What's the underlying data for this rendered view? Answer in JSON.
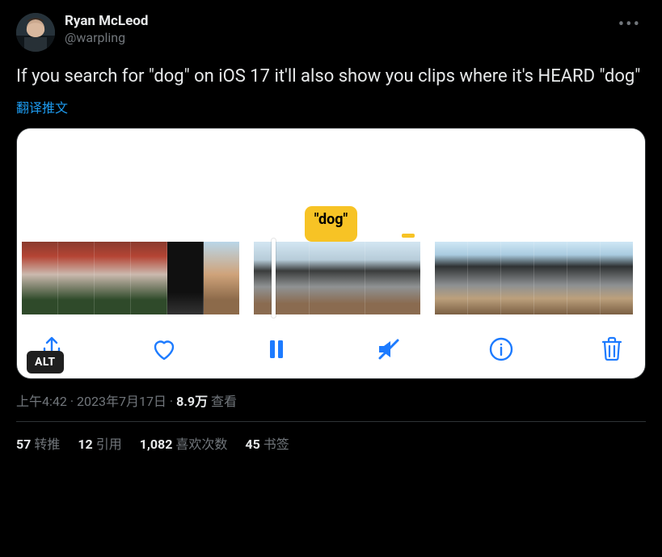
{
  "header": {
    "display_name": "Ryan McLeod",
    "handle": "@warpling",
    "more_label": "More"
  },
  "tweet": {
    "text": "If you search for \"dog\" on iOS 17 it'll also show you clips where it's HEARD \"dog\"",
    "translate_label": "翻译推文"
  },
  "media": {
    "search_pill": "\"dog\"",
    "alt_badge": "ALT",
    "toolbar": {
      "share": "Share",
      "like": "Like",
      "pause": "Pause",
      "mute": "Muted",
      "info": "Info",
      "trash": "Delete"
    }
  },
  "meta": {
    "time": "上午4:42",
    "dot1": " · ",
    "date": "2023年7月17日",
    "dot2": " · ",
    "views_value": "8.9万",
    "views_label": " 查看"
  },
  "stats": {
    "retweets_count": "57",
    "retweets_label": "转推",
    "quotes_count": "12",
    "quotes_label": "引用",
    "likes_count": "1,082",
    "likes_label": "喜欢次数",
    "bookmarks_count": "45",
    "bookmarks_label": "书签"
  }
}
